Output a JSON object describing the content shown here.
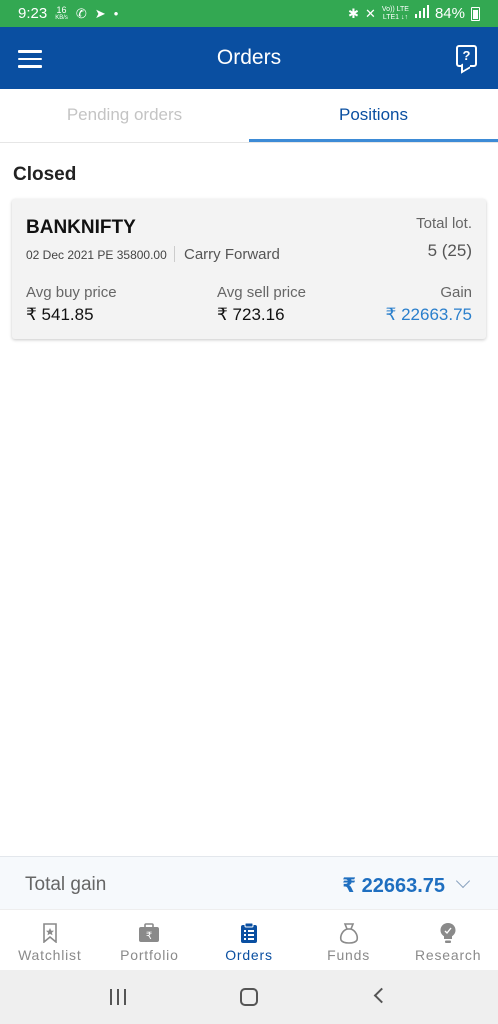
{
  "status_bar": {
    "time": "9:23",
    "speed_value": "16",
    "speed_unit": "KB/s",
    "network_top": "Vo)) LTE",
    "network_bottom": "LTE1 ↓↑",
    "battery": "84%"
  },
  "header": {
    "title": "Orders",
    "help_glyph": "?"
  },
  "tabs": [
    {
      "label": "Pending orders",
      "active": false
    },
    {
      "label": "Positions",
      "active": true
    }
  ],
  "section": {
    "title": "Closed"
  },
  "position": {
    "symbol": "BANKNIFTY",
    "contract": "02 Dec 2021 PE 35800.00",
    "product": "Carry Forward",
    "total_lot_label": "Total lot.",
    "total_lot_value": "5 (25)",
    "avg_buy_label": "Avg buy price",
    "avg_buy_value": "₹ 541.85",
    "avg_sell_label": "Avg sell price",
    "avg_sell_value": "₹ 723.16",
    "gain_label": "Gain",
    "gain_value": "₹ 22663.75"
  },
  "total_gain": {
    "label": "Total gain",
    "value": "₹ 22663.75"
  },
  "bottom_nav": [
    {
      "label": "Watchlist",
      "icon": "bookmark-star-icon",
      "active": false
    },
    {
      "label": "Portfolio",
      "icon": "briefcase-rupee-icon",
      "active": false
    },
    {
      "label": "Orders",
      "icon": "clipboard-list-icon",
      "active": true
    },
    {
      "label": "Funds",
      "icon": "money-bag-icon",
      "active": false
    },
    {
      "label": "Research",
      "icon": "lightbulb-icon",
      "active": false
    }
  ],
  "colors": {
    "status_bar": "#33a852",
    "header": "#0a4fa1",
    "accent": "#3d8bd6",
    "gain": "#2a7fcc"
  }
}
